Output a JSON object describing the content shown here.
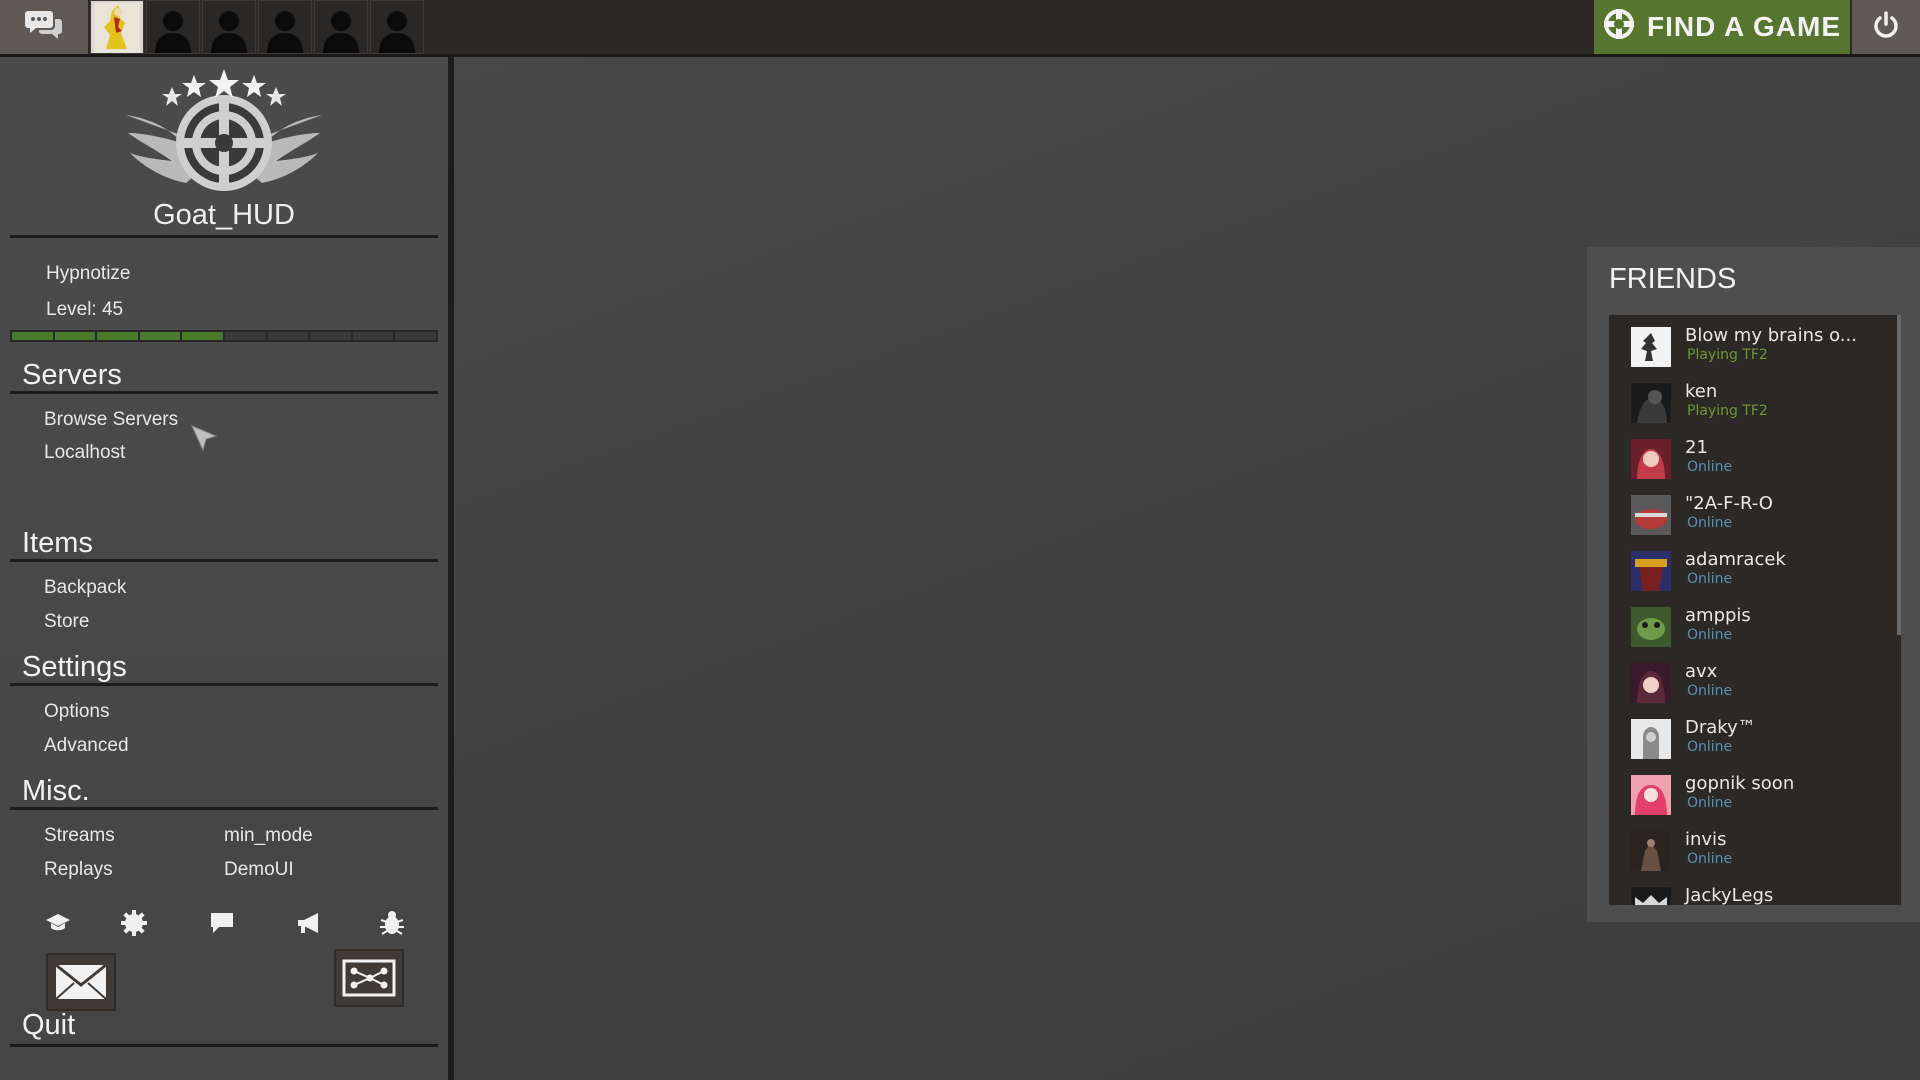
{
  "topbar": {
    "find_game_label": "FIND A GAME",
    "party_slot_count": 6
  },
  "profile": {
    "username": "Goat_HUD",
    "title": "Hypnotize",
    "level_label": "Level: 45",
    "xp_progress": 0.5
  },
  "menu": {
    "servers": {
      "title": "Servers",
      "browse": "Browse Servers",
      "localhost": "Localhost"
    },
    "items": {
      "title": "Items",
      "backpack": "Backpack",
      "store": "Store"
    },
    "settings": {
      "title": "Settings",
      "options": "Options",
      "advanced": "Advanced"
    },
    "misc": {
      "title": "Misc.",
      "streams": "Streams",
      "replays": "Replays",
      "min_mode": "min_mode",
      "demoui": "DemoUI"
    },
    "quit": "Quit"
  },
  "friends": {
    "title": "FRIENDS",
    "list": [
      {
        "name": "Blow my brains o...",
        "status": "Playing TF2",
        "status_color": "#6c9a2d"
      },
      {
        "name": "ken",
        "status": "Playing TF2",
        "status_color": "#6c9a2d"
      },
      {
        "name": "21",
        "status": "Online",
        "status_color": "#5b8fb3"
      },
      {
        "name": "\"2A-F-R-O",
        "status": "Online",
        "status_color": "#5b8fb3"
      },
      {
        "name": "adamracek",
        "status": "Online",
        "status_color": "#5b8fb3"
      },
      {
        "name": "amppis",
        "status": "Online",
        "status_color": "#5b8fb3"
      },
      {
        "name": "avx",
        "status": "Online",
        "status_color": "#5b8fb3"
      },
      {
        "name": "Draky™",
        "status": "Online",
        "status_color": "#5b8fb3"
      },
      {
        "name": "gopnik soon",
        "status": "Online",
        "status_color": "#5b8fb3"
      },
      {
        "name": "invis",
        "status": "Online",
        "status_color": "#5b8fb3"
      },
      {
        "name": "JackyLegs",
        "status": "",
        "status_color": "#5b8fb3"
      }
    ]
  },
  "colors": {
    "find_game_bg": "#56752f",
    "playing_green": "#6c9a2d",
    "online_blue": "#5b8fb3"
  }
}
